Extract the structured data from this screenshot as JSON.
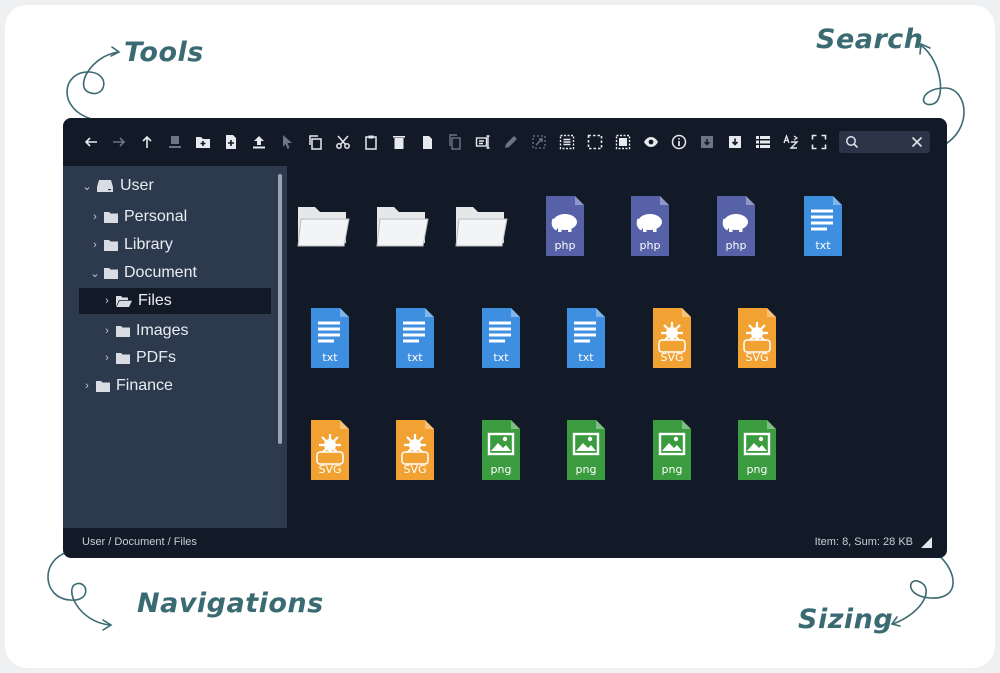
{
  "callouts": {
    "tools": "Tools",
    "search": "Search",
    "navigations": "Navigations",
    "sizing": "Sizing"
  },
  "colors": {
    "panel": "#121a27",
    "sidebar": "#2d3a4e",
    "php": "#5661a8",
    "txt": "#3f8fe0",
    "svg": "#f2a233",
    "png": "#3a9b3f",
    "folder": "#e6e7e8",
    "callout": "#3b6b72"
  },
  "toolbar": {
    "buttons": [
      {
        "icon": "arrow-left-icon",
        "enabled": true
      },
      {
        "icon": "arrow-right-icon",
        "enabled": false
      },
      {
        "icon": "arrow-up-icon",
        "enabled": true
      },
      {
        "icon": "upload-to-server-icon",
        "enabled": false
      },
      {
        "icon": "new-folder-icon",
        "enabled": true
      },
      {
        "icon": "new-file-icon",
        "enabled": true
      },
      {
        "icon": "upload-icon",
        "enabled": true
      },
      {
        "icon": "pointer-icon",
        "enabled": false
      },
      {
        "icon": "copy-icon",
        "enabled": true
      },
      {
        "icon": "cut-icon",
        "enabled": true
      },
      {
        "icon": "paste-icon",
        "enabled": true
      },
      {
        "icon": "delete-icon",
        "enabled": true
      },
      {
        "icon": "duplicate-icon",
        "enabled": true
      },
      {
        "icon": "copy-path-icon",
        "enabled": false
      },
      {
        "icon": "rename-icon",
        "enabled": true
      },
      {
        "icon": "edit-icon",
        "enabled": false
      },
      {
        "icon": "resize-icon",
        "enabled": false
      },
      {
        "icon": "select-all-icon",
        "enabled": true
      },
      {
        "icon": "select-none-icon",
        "enabled": true
      },
      {
        "icon": "invert-selection-icon",
        "enabled": true
      },
      {
        "icon": "preview-icon",
        "enabled": true
      },
      {
        "icon": "info-icon",
        "enabled": true
      },
      {
        "icon": "extract-icon",
        "enabled": false
      },
      {
        "icon": "archive-icon",
        "enabled": true
      },
      {
        "icon": "list-view-icon",
        "enabled": true
      },
      {
        "icon": "sort-az-icon",
        "enabled": true
      },
      {
        "icon": "fullscreen-icon",
        "enabled": true
      }
    ],
    "search_value": ""
  },
  "tree": [
    {
      "label": "User",
      "icon": "drive-icon",
      "expanded": true,
      "level": 0
    },
    {
      "label": "Personal",
      "icon": "folder-icon",
      "expanded": false,
      "level": 1
    },
    {
      "label": "Library",
      "icon": "folder-icon",
      "expanded": false,
      "level": 1
    },
    {
      "label": "Document",
      "icon": "folder-icon",
      "expanded": true,
      "level": 1
    },
    {
      "label": "Files",
      "icon": "folder-open-icon",
      "expanded": false,
      "level": 2,
      "selected": true
    },
    {
      "label": "Images",
      "icon": "folder-icon",
      "expanded": false,
      "level": 2
    },
    {
      "label": "PDFs",
      "icon": "folder-icon",
      "expanded": false,
      "level": 2
    },
    {
      "label": "Finance",
      "icon": "folder-icon",
      "expanded": false,
      "level": 0
    }
  ],
  "files": [
    {
      "type": "folder"
    },
    {
      "type": "folder"
    },
    {
      "type": "folder"
    },
    {
      "type": "php",
      "label": "php"
    },
    {
      "type": "php",
      "label": "php"
    },
    {
      "type": "php",
      "label": "php"
    },
    {
      "type": "txt",
      "label": "txt"
    },
    {
      "type": "txt",
      "label": "txt"
    },
    {
      "type": "txt",
      "label": "txt"
    },
    {
      "type": "txt",
      "label": "txt"
    },
    {
      "type": "txt",
      "label": "txt"
    },
    {
      "type": "svg",
      "label": "SVG"
    },
    {
      "type": "svg",
      "label": "SVG"
    },
    {
      "type": "svg",
      "label": "SVG"
    },
    {
      "type": "svg",
      "label": "SVG"
    },
    {
      "type": "png",
      "label": "png"
    },
    {
      "type": "png",
      "label": "png"
    },
    {
      "type": "png",
      "label": "png"
    },
    {
      "type": "png",
      "label": "png"
    }
  ],
  "status": {
    "breadcrumb": "User / Document / Files",
    "info": "Item: 8, Sum: 28 KB"
  }
}
